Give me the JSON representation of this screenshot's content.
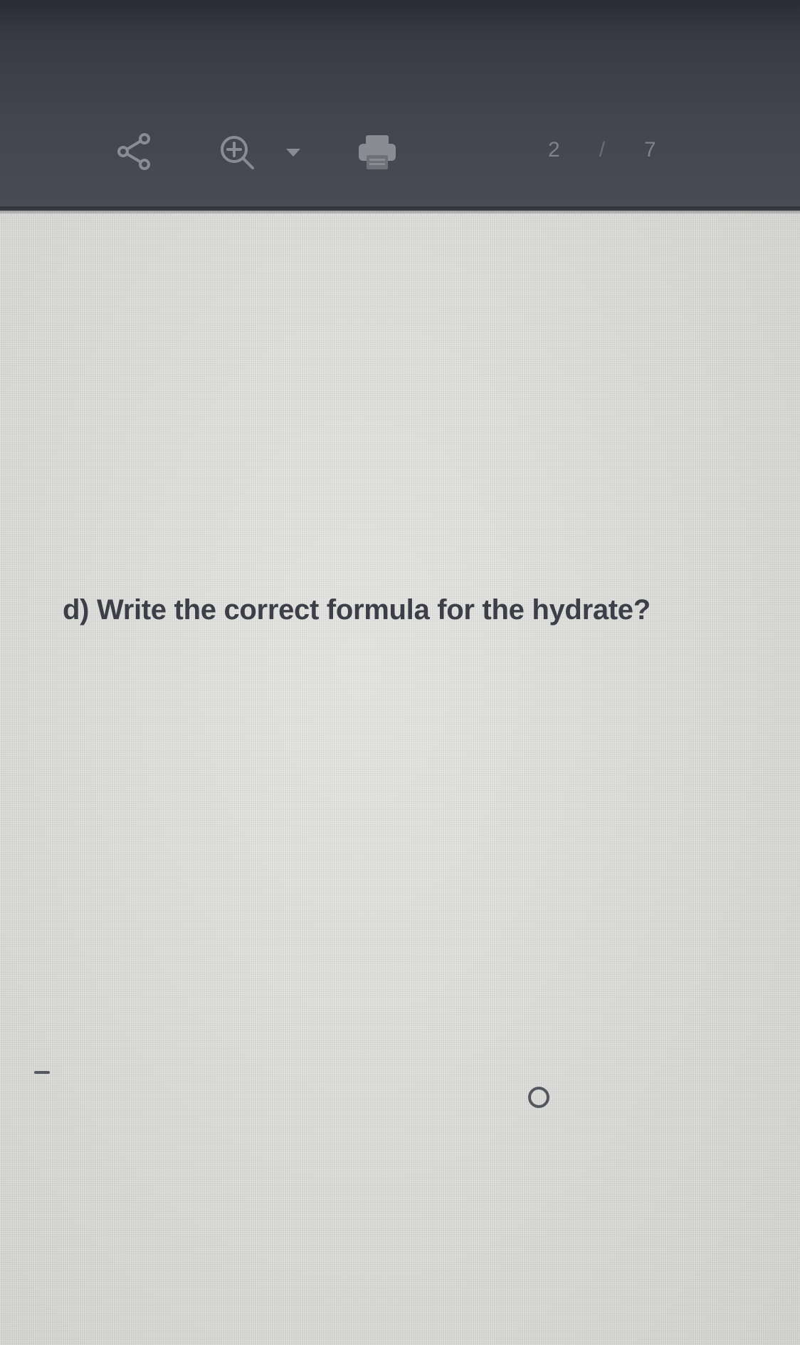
{
  "toolbar": {
    "share_icon": "share-icon",
    "zoom_icon": "zoom-in-icon",
    "zoom_caret_icon": "chevron-down-icon",
    "print_icon": "printer-icon",
    "page_current": "2",
    "page_separator": "/",
    "page_total": "7"
  },
  "document": {
    "question": "d) Write the correct formula for the hydrate?"
  },
  "colors": {
    "toolbar_bg": "#42444e",
    "page_bg": "#dfe0dd",
    "text": "#3c3f47"
  }
}
